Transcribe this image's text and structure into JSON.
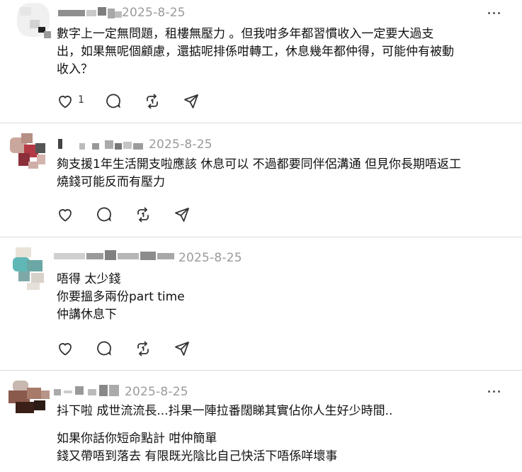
{
  "posts": [
    {
      "date": "2025-8-25",
      "lines": [
        "數字上一定無問題，租樓無壓力 。但我咁多年都習慣收入一定要大過支",
        "出，如果無呢個顧慮，還掂呢排係咁轉工，休息幾年都仲得，可能仲有被動",
        "收入？"
      ],
      "like_count": "1",
      "icons": [
        "heart-icon",
        "comment-icon",
        "repost-icon",
        "share-icon",
        "more-icon"
      ]
    },
    {
      "date": "2025-8-25",
      "lines": [
        "夠支援1年生活開支啦應該 休息可以 不過都要同伴侶溝通 但見你長期唔返工",
        "燒錢可能反而有壓力"
      ],
      "like_count": "",
      "icons": [
        "heart-icon",
        "comment-icon",
        "repost-icon",
        "share-icon",
        "more-icon"
      ]
    },
    {
      "date": "2025-8-25",
      "lines": [
        "唔得 太少錢",
        "你要搵多兩份part time",
        "仲講休息下"
      ],
      "like_count": "",
      "icons": [
        "heart-icon",
        "comment-icon",
        "repost-icon",
        "share-icon",
        "more-icon"
      ]
    },
    {
      "date": "2025-8-25",
      "lines": [
        "抖下啦 成世流流長...抖果一陣拉番闊睇其實佔你人生好少時間..",
        "",
        "如果你話你短命點計 咁仲簡單",
        "錢又帶唔到落去 有限既光陰比自己快活下唔係咩壞事"
      ],
      "like_count": "",
      "icons": [
        "heart-icon",
        "comment-icon",
        "repost-icon",
        "share-icon",
        "more-icon"
      ]
    }
  ]
}
